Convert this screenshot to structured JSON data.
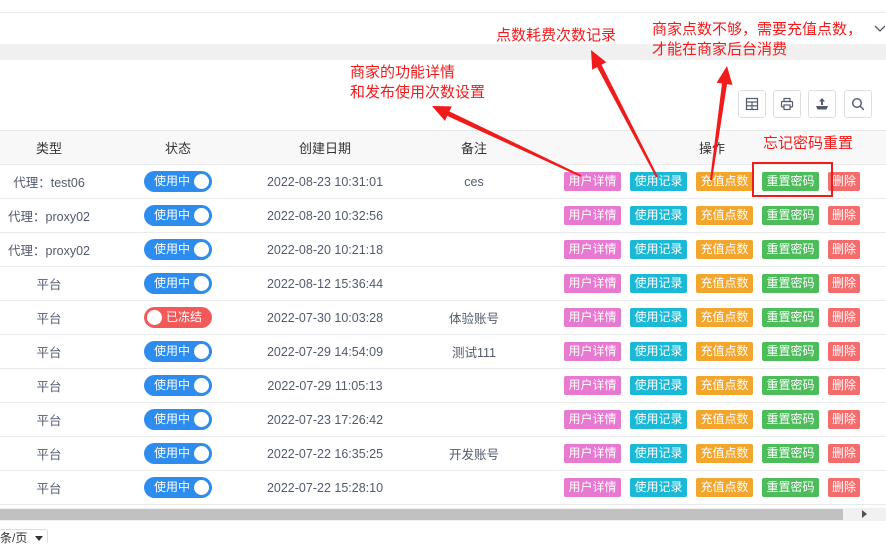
{
  "annotations": {
    "usage_note": "点数耗费次数记录",
    "recharge_note": [
      "商家点数不够，需要充值点数，",
      "才能在商家后台消费"
    ],
    "details_note": [
      "商家的功能详情",
      "和发布使用次数设置"
    ],
    "reset_note": "忘记密码重置"
  },
  "header_bar": {
    "collapse_icon": "chevron-down-icon"
  },
  "toolbar": {
    "icons": [
      "columns-icon",
      "printer-icon",
      "export-icon",
      "search-icon"
    ]
  },
  "table": {
    "headers": {
      "type": "类型",
      "status": "状态",
      "created": "创建日期",
      "remark": "备注",
      "actions": "操作"
    },
    "rows": [
      {
        "type": "代理：test06",
        "status": "使用中",
        "created": "2022-08-23 10:31:01",
        "remark": "ces"
      },
      {
        "type": "代理：proxy02",
        "status": "使用中",
        "created": "2022-08-20 10:32:56",
        "remark": ""
      },
      {
        "type": "代理：proxy02",
        "status": "使用中",
        "created": "2022-08-20 10:21:18",
        "remark": ""
      },
      {
        "type": "平台",
        "status": "使用中",
        "created": "2022-08-12 15:36:44",
        "remark": ""
      },
      {
        "type": "平台",
        "status": "已冻结",
        "created": "2022-07-30 10:03:28",
        "remark": "体验账号"
      },
      {
        "type": "平台",
        "status": "使用中",
        "created": "2022-07-29 14:54:09",
        "remark": "测试111"
      },
      {
        "type": "平台",
        "status": "使用中",
        "created": "2022-07-29 11:05:13",
        "remark": ""
      },
      {
        "type": "平台",
        "status": "使用中",
        "created": "2022-07-23 17:26:42",
        "remark": ""
      },
      {
        "type": "平台",
        "status": "使用中",
        "created": "2022-07-22 16:35:25",
        "remark": "开发账号"
      },
      {
        "type": "平台",
        "status": "使用中",
        "created": "2022-07-22 15:28:10",
        "remark": ""
      }
    ]
  },
  "actions": {
    "details": "用户详情",
    "usage": "使用记录",
    "recharge": "充值点数",
    "reset": "重置密码",
    "delete": "删除"
  },
  "pagination": {
    "page_size_label": "条/页"
  },
  "colors": {
    "status_active": "#2d8cf0",
    "status_frozen": "#f25a5a",
    "details_button": "#e879d0",
    "usage_button": "#1cb9d6",
    "recharge_button": "#f3a62d",
    "reset_button": "#4dbd5c",
    "delete_button": "#f46c6c",
    "annotation": "#f21b1b"
  }
}
